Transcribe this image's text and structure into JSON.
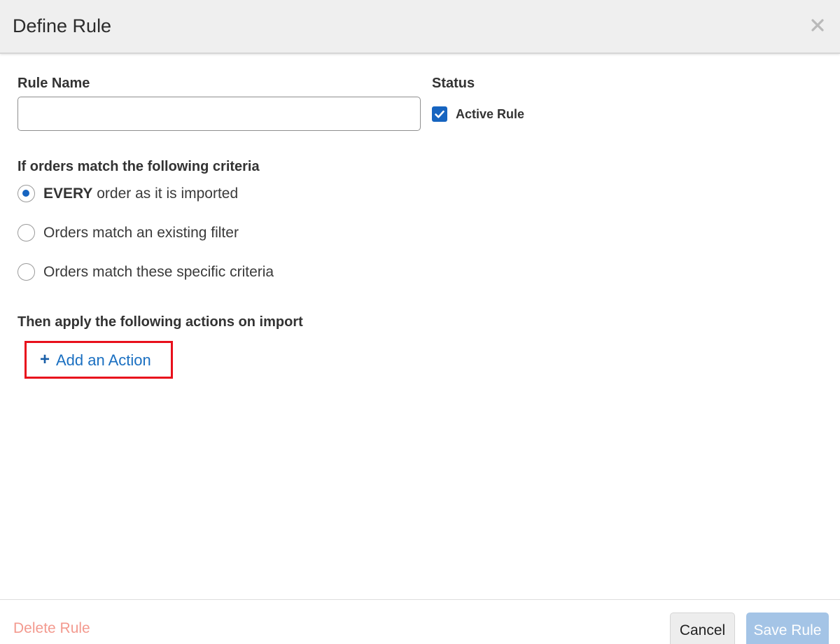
{
  "dialog": {
    "title": "Define Rule",
    "close_icon": "close-icon"
  },
  "form": {
    "rule_name_label": "Rule Name",
    "rule_name_value": "",
    "rule_name_placeholder": "",
    "status_label": "Status",
    "active_rule_label": "Active Rule",
    "active_rule_checked": true
  },
  "criteria": {
    "heading": "If orders match the following criteria",
    "options": [
      {
        "bold": "EVERY",
        "text": " order as it is imported",
        "selected": true
      },
      {
        "bold": "",
        "text": "Orders match an existing filter",
        "selected": false
      },
      {
        "bold": "",
        "text": "Orders match these specific criteria",
        "selected": false
      }
    ]
  },
  "actions": {
    "heading": "Then apply the following actions on import",
    "add_symbol": "+",
    "add_label": "Add an Action",
    "highlight_color": "#e8101c"
  },
  "footer": {
    "delete_label": "Delete Rule",
    "cancel_label": "Cancel",
    "save_label": "Save Rule"
  },
  "colors": {
    "accent": "#1664c0",
    "link": "#1a6fc1",
    "danger_muted": "#f39a8f",
    "save_disabled": "#a4c4e6"
  }
}
